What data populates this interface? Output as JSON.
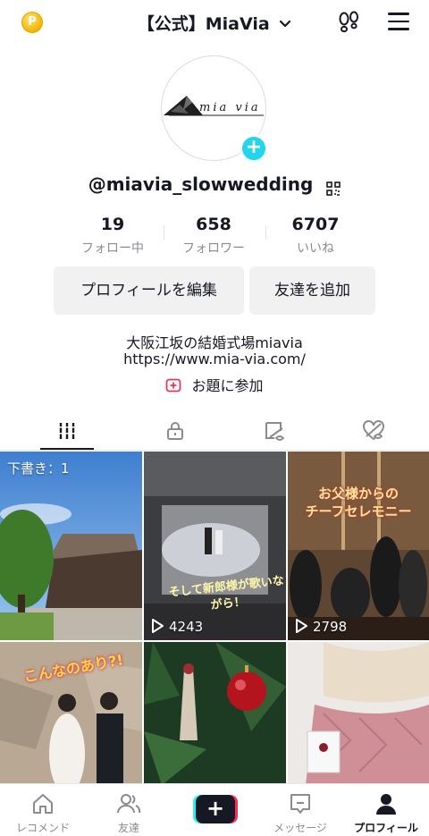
{
  "header": {
    "coin_symbol": "P",
    "account_name": "【公式】MiaVia",
    "icons": [
      "coin-icon",
      "chevron-down-icon",
      "footprint-icon",
      "menu-icon"
    ]
  },
  "profile": {
    "avatar_text": "mia via",
    "username": "@miavia_slowwedding",
    "stats": [
      {
        "value": "19",
        "label": "フォロー中"
      },
      {
        "value": "658",
        "label": "フォロワー"
      },
      {
        "value": "6707",
        "label": "いいね"
      }
    ],
    "buttons": {
      "edit": "プロフィールを編集",
      "add_friend": "友達を追加"
    },
    "bio_line1": "大阪江坂の結婚式場miavia",
    "bio_line2": "https://www.mia-via.com/",
    "topic": "お題に参加"
  },
  "tabs": [
    "videos-grid-icon",
    "lock-icon",
    "tagged-icon",
    "liked-icon"
  ],
  "videos": [
    {
      "badge": "下書き：1"
    },
    {
      "caption": "そして新郎様が歌いながら！",
      "views": "4243"
    },
    {
      "caption_line1": "お父様からの",
      "caption_line2": "チーフセレモニー",
      "views": "2798"
    },
    {
      "caption": "こんなのあり?!"
    },
    {},
    {}
  ],
  "bottom_nav": [
    {
      "label": "レコメンド"
    },
    {
      "label": "友達"
    },
    {
      "label": "+"
    },
    {
      "label": "メッセージ"
    },
    {
      "label": "プロフィール"
    }
  ],
  "colors": {
    "accent_cyan": "#20d5ec",
    "accent_red": "#fe2c55",
    "text": "#161823",
    "muted": "#8a8b91"
  }
}
